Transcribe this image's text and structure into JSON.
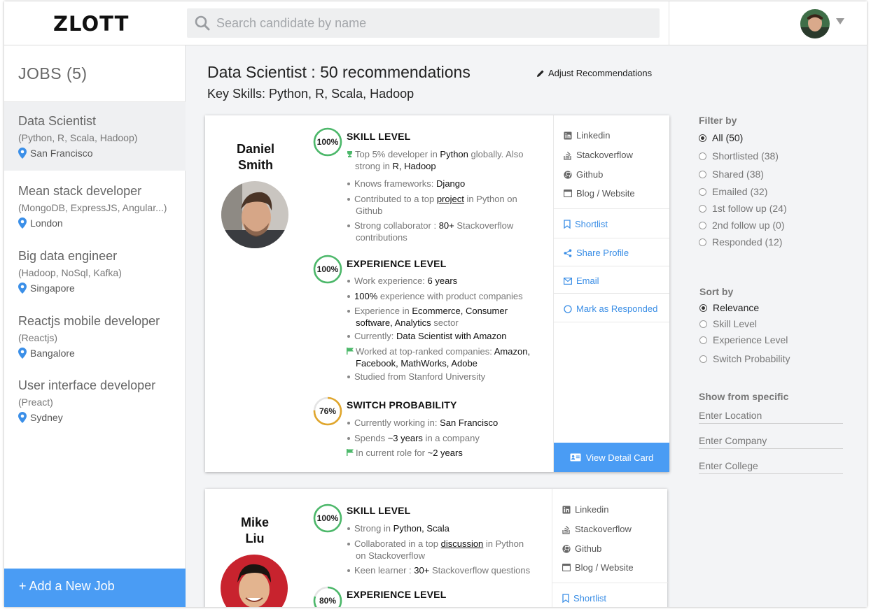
{
  "app": {
    "logo": "ZLOTT"
  },
  "search": {
    "placeholder": "Search candidate by name"
  },
  "sidebar": {
    "title": "JOBS (5)",
    "jobs": [
      {
        "title": "Data Scientist",
        "skills": "(Python, R, Scala, Hadoop)",
        "location": "San Francisco"
      },
      {
        "title": "Mean stack developer",
        "skills": "(MongoDB, ExpressJS, Angular...)",
        "location": "London"
      },
      {
        "title": "Big data engineer",
        "skills": "(Hadoop, NoSql, Kafka)",
        "location": "Singapore"
      },
      {
        "title": "Reactjs mobile developer",
        "skills": "(Reactjs)",
        "location": "Bangalore"
      },
      {
        "title": "User interface developer",
        "skills": "(Preact)",
        "location": "Sydney"
      }
    ],
    "add_job": "+ Add a New Job"
  },
  "header": {
    "title": "Data Scientist : 50 recommendations",
    "skills": "Key Skills: Python, R, Scala, Hadoop",
    "adjust": "Adjust Recommendations"
  },
  "cards": [
    {
      "name_line1": "Daniel",
      "name_line2": "Smith",
      "skill": {
        "score": "100%",
        "value": 100,
        "title": "SKILL LEVEL",
        "b1": {
          "a": "Top 5% developer in ",
          "b": "Python",
          "c": " globally. Also",
          "d": "strong in ",
          "e": "R, Hadoop"
        },
        "b2": {
          "a": "Knows frameworks: ",
          "b": "Django"
        },
        "b3": {
          "a": "Contributed to a top ",
          "b": "project",
          "c": " in Python on",
          "d": "Github"
        },
        "b4": {
          "a": "Strong collaborator : ",
          "b": "80+",
          "c": " Stackoverflow",
          "d": "contributions"
        }
      },
      "experience": {
        "score": "100%",
        "value": 100,
        "title": "EXPERIENCE LEVEL",
        "b1": {
          "a": "Work experience: ",
          "b": "6 years"
        },
        "b2": {
          "a": "100%",
          "b": " experience with product companies"
        },
        "b3": {
          "a": "Experience in ",
          "b": "Ecommerce, Consumer",
          "c": "software, Analytics",
          "d": " sector"
        },
        "b4": {
          "a": "Currently: ",
          "b": "Data Scientist with Amazon"
        },
        "b5": {
          "a": "Worked at top-ranked companies: ",
          "b": "Amazon,",
          "c": "Facebook, MathWorks, Adobe"
        },
        "b6": {
          "a": "Studied from Stanford University"
        }
      },
      "switch": {
        "score": "76%",
        "value": 76,
        "title": "SWITCH PROBABILITY",
        "b1": {
          "a": "Currently working in: ",
          "b": "San Francisco"
        },
        "b2": {
          "a": "Spends ",
          "b": "~3 years",
          "c": " in a company"
        },
        "b3": {
          "a": "In current role for ",
          "b": "~2 years"
        }
      },
      "links": [
        "Linkedin",
        "Stackoverflow",
        "Github",
        "Blog / Website"
      ],
      "actions": [
        "Shortlist",
        "Share Profile",
        "Email",
        "Mark as Responded"
      ],
      "view": "View Detail Card"
    },
    {
      "name_line1": "Mike",
      "name_line2": "Liu",
      "skill": {
        "score": "100%",
        "value": 100,
        "title": "SKILL LEVEL",
        "b1": {
          "a": "Strong in ",
          "b": "Python, Scala"
        },
        "b2": {
          "a": "Collaborated in a top ",
          "b": "discussion",
          "c": " in Python",
          "d": "on Stackoverflow"
        },
        "b3": {
          "a": "Keen learner : ",
          "b": "30+",
          "c": " Stackoverflow questions"
        }
      },
      "experience": {
        "score": "80%",
        "value": 80,
        "title": "EXPERIENCE LEVEL"
      },
      "links": [
        "Linkedin",
        "Stackoverflow",
        "Github",
        "Blog / Website"
      ],
      "actions": [
        "Shortlist"
      ]
    }
  ],
  "filters": {
    "filter_title": "Filter by",
    "filter_options": [
      "All (50)",
      "Shortlisted (38)",
      "Shared (38)",
      "Emailed (32)",
      "1st follow up (24)",
      "2nd follow up (0)",
      "Responded (12)"
    ],
    "filter_selected": "All (50)",
    "sort_title": "Sort by",
    "sort_options": [
      "Relevance",
      "Skill Level",
      "Experience Level",
      "Switch Probability"
    ],
    "sort_selected": "Relevance",
    "specific_title": "Show from specific",
    "location_placeholder": "Enter Location",
    "company_placeholder": "Enter Company",
    "college_placeholder": "Enter College"
  },
  "colors": {
    "accent": "#4a9cf4",
    "link": "#3a8ee6",
    "gauge_green": "#4cb86a",
    "gauge_orange": "#e0a62c",
    "pin": "#3b8fe8"
  }
}
